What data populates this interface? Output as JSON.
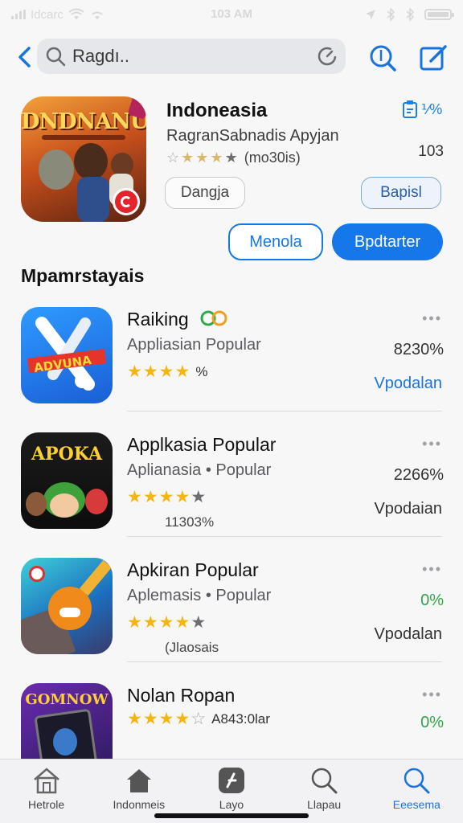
{
  "status_bar": {
    "carrier": "Idcarc",
    "time": "103 AM",
    "icons": [
      "signal-icon",
      "wifi-icon",
      "location-icon",
      "bluetooth-icon",
      "battery-icon"
    ]
  },
  "search": {
    "value": "Ragdı.."
  },
  "featured": {
    "title": "Indoneasia",
    "subtitle": "RagranSabnadis Apyjan",
    "art_title": "DNDNANUN",
    "rating_count": "(mo30is)",
    "top_right": "⅟%",
    "size": "103",
    "rating_stars": 4,
    "buttons": {
      "secondary_left": "Dangja",
      "secondary_right": "Bapisl",
      "outline": "Menola",
      "primary": "Bpdtarter"
    }
  },
  "section_title": "Mpamrstayais",
  "apps": [
    {
      "name": "Raiking",
      "subtitle": "Appliasian Popular",
      "stars_extra": "%",
      "note": "",
      "percent": "8230%",
      "percent_color": "#333333",
      "action": "Vpodalan",
      "action_color": "#1a74e0",
      "more": "•••",
      "art_text": "ADVUNA",
      "rating": 4
    },
    {
      "name": "Applkasia Popular",
      "subtitle": "Aplianasia • Popular",
      "stars_extra": "",
      "note": "11303%",
      "percent": "2266%",
      "percent_color": "#333333",
      "action": "Vpodaian",
      "action_color": "#333333",
      "more": "•••",
      "art_text": "APOKA",
      "rating": 4
    },
    {
      "name": "Apkiran Popular",
      "subtitle": "Aplemasis • Popular",
      "stars_extra": "",
      "note": "(Jlaosais",
      "percent": "0%",
      "percent_color": "#2ea84a",
      "action": "Vpodalan",
      "action_color": "#333333",
      "more": "•••",
      "art_text": "",
      "rating": 4
    },
    {
      "name": "Nolan Ropan",
      "subtitle": "",
      "stars_extra": "A843:0lar",
      "note": "",
      "percent": "0%",
      "percent_color": "#2ea84a",
      "action": "",
      "action_color": "#333333",
      "more": "•••",
      "art_text": "GOMNOW",
      "rating": 4
    }
  ],
  "tabs": [
    {
      "label": "Hetrole",
      "icon": "house-icon",
      "active": false
    },
    {
      "label": "Indonmeis",
      "icon": "home-filled-icon",
      "active": false
    },
    {
      "label": "Layo",
      "icon": "app-store-icon",
      "active": false
    },
    {
      "label": "Llapau",
      "icon": "search-icon",
      "active": false
    },
    {
      "label": "Eeesema",
      "icon": "search-icon",
      "active": true
    }
  ],
  "colors": {
    "accent": "#1477ea",
    "star": "#f4b612",
    "green": "#2ea84a"
  }
}
